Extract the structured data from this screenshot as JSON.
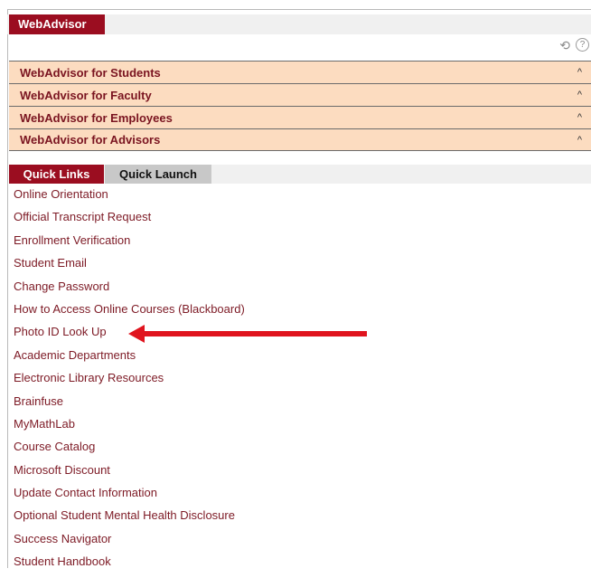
{
  "header": {
    "tab_label": "WebAdvisor"
  },
  "toolbar": {
    "refresh_icon": "refresh-icon",
    "help_icon": "help-icon"
  },
  "accordion": [
    {
      "label": "WebAdvisor for Students"
    },
    {
      "label": "WebAdvisor for Faculty"
    },
    {
      "label": "WebAdvisor for Employees"
    },
    {
      "label": "WebAdvisor for Advisors"
    }
  ],
  "tabs": {
    "quick_links": "Quick Links",
    "quick_launch": "Quick Launch"
  },
  "links": [
    "Online Orientation",
    "Official Transcript Request",
    "Enrollment Verification",
    "Student Email",
    "Change Password",
    "How to Access Online Courses (Blackboard)",
    "Photo ID Look Up",
    "Academic Departments",
    "Electronic Library Resources",
    "Brainfuse",
    "MyMathLab",
    "Course Catalog",
    "Microsoft Discount",
    "Update Contact Information",
    "Optional Student Mental Health Disclosure",
    "Success Navigator",
    "Student Handbook"
  ],
  "colors": {
    "brand": "#9b0d20",
    "accordion_bg": "#fcdcc0",
    "link": "#7d1a25",
    "arrow": "#e0141e"
  }
}
